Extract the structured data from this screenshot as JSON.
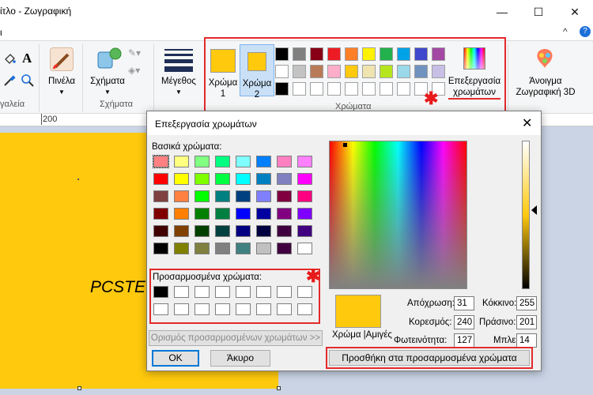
{
  "window": {
    "title": "ίτλο - Ζωγραφική",
    "controls": [
      "—",
      "☐",
      "✕"
    ]
  },
  "menu": {
    "left_fragment": "ι",
    "collapse": "^",
    "help": "?"
  },
  "ribbon": {
    "tools_label": "γαλεία",
    "brushes_label": "Πινέλα",
    "shapes_label": "Σχήματα",
    "shapes_group_label": "Σχήματα",
    "size_label": "Μέγεθος",
    "color1_label": "Χρώμα 1",
    "color2_label": "Χρώμα 2",
    "colors_group_label": "Χρώματα",
    "edit_colors_label": "Επεξεργασία χρωμάτων",
    "paint3d_label": "Άνοιγμα Ζωγραφική 3D",
    "color1_value": "#ffc90e",
    "color2_value": "#ffc90e",
    "palette_row1": [
      "#000000",
      "#7f7f7f",
      "#880015",
      "#ed1c24",
      "#ff7f27",
      "#fff200",
      "#22b14c",
      "#00a2e8",
      "#3f48cc",
      "#a349a4"
    ],
    "palette_row2": [
      "#ffffff",
      "#c3c3c3",
      "#b97a57",
      "#ffaec9",
      "#ffc90e",
      "#efe4b0",
      "#b5e61d",
      "#99d9ea",
      "#7092be",
      "#c8bfe7"
    ],
    "palette_row3": [
      "#000000",
      "",
      "",
      "",
      "",
      "",
      "",
      "",
      "",
      ""
    ]
  },
  "ruler": {
    "mark_200": "200"
  },
  "canvas": {
    "text": "PCSTE"
  },
  "dialog": {
    "title": "Επεξεργασία χρωμάτων",
    "close": "✕",
    "basic_colors_label": "Βασικά χρώματα:",
    "basic_colors": [
      [
        "#ff8080",
        "#ffff80",
        "#80ff80",
        "#00ff80",
        "#80ffff",
        "#0080ff",
        "#ff80c0",
        "#ff80ff"
      ],
      [
        "#ff0000",
        "#ffff00",
        "#80ff00",
        "#00ff40",
        "#00ffff",
        "#0080c0",
        "#8080c0",
        "#ff00ff"
      ],
      [
        "#804040",
        "#ff8040",
        "#00ff00",
        "#008080",
        "#004080",
        "#8080ff",
        "#800040",
        "#ff0080"
      ],
      [
        "#800000",
        "#ff8000",
        "#008000",
        "#008040",
        "#0000ff",
        "#0000a0",
        "#800080",
        "#8000ff"
      ],
      [
        "#400000",
        "#804000",
        "#004000",
        "#004040",
        "#000080",
        "#000040",
        "#400040",
        "#400080"
      ],
      [
        "#000000",
        "#808000",
        "#808040",
        "#808080",
        "#408080",
        "#c0c0c0",
        "#400040",
        "#ffffff"
      ]
    ],
    "custom_colors_label": "Προσαρμοσμένα χρώματα:",
    "custom_colors": [
      [
        "#000000",
        "#ffffff",
        "#ffffff",
        "#ffffff",
        "#ffffff",
        "#ffffff",
        "#ffffff",
        "#ffffff"
      ],
      [
        "#ffffff",
        "#ffffff",
        "#ffffff",
        "#ffffff",
        "#ffffff",
        "#ffffff",
        "#ffffff",
        "#ffffff"
      ]
    ],
    "define_custom_button": "Ορισμός προσαρμοσμένων χρωμάτων >>",
    "ok_button": "OK",
    "cancel_button": "Άκυρο",
    "color_solid_label": "Χρώμα |Αμιγές",
    "preview_color": "#ffc90e",
    "hue_label": "Απόχρωση:",
    "hue": "31",
    "sat_label": "Κορεσμός:",
    "sat": "240",
    "lum_label": "Φωτεινότητα:",
    "lum": "127",
    "red_label": "Κόκκινο:",
    "red": "255",
    "green_label": "Πράσινο:",
    "green": "201",
    "blue_label": "Μπλε:",
    "blue": "14",
    "add_custom_button": "Προσθήκη στα προσαρμοσμένα χρώματα"
  },
  "annotation_marker": "✱"
}
